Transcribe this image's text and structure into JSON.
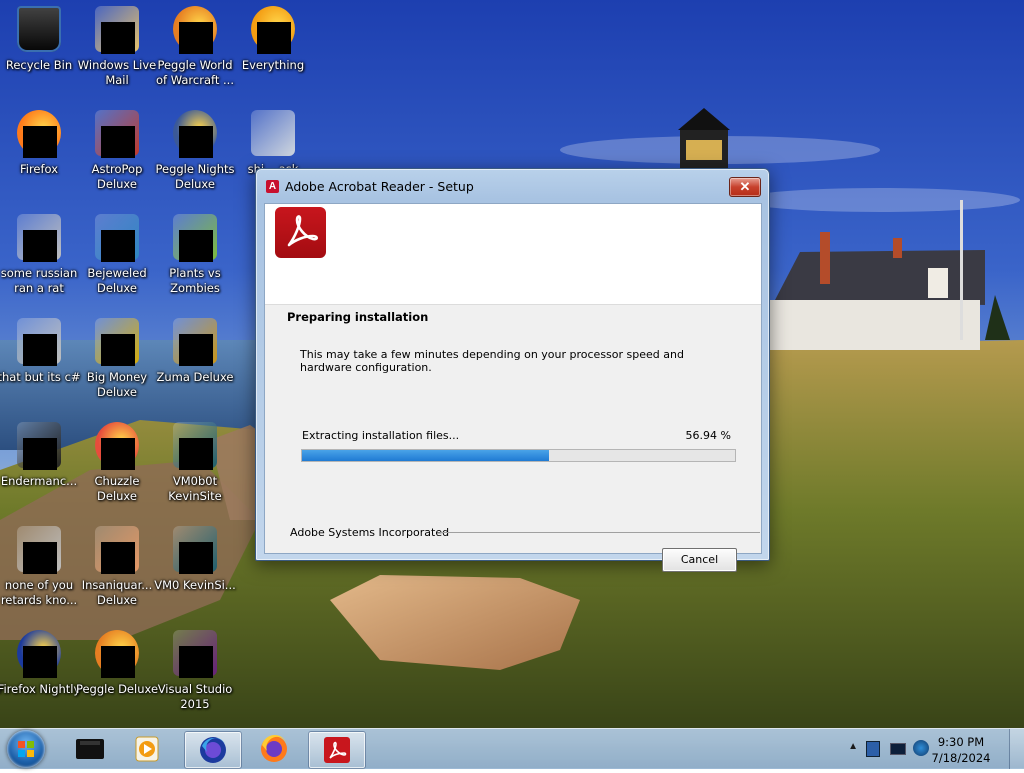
{
  "desktop": {
    "icons": [
      {
        "label": "Recycle Bin",
        "icon": "recycle-bin-icon",
        "redacted": false
      },
      {
        "label": "Windows Live Mail",
        "icon": "mail-icon",
        "redacted": true
      },
      {
        "label": "Peggle World of Warcraft ...",
        "icon": "peggle-wow-icon",
        "redacted": true
      },
      {
        "label": "Everything",
        "icon": "everything-icon",
        "redacted": true
      },
      {
        "label": "Firefox",
        "icon": "firefox-icon",
        "redacted": true
      },
      {
        "label": "AstroPop Deluxe",
        "icon": "astropop-icon",
        "redacted": true
      },
      {
        "label": "Peggle Nights Deluxe",
        "icon": "peggle-nights-icon",
        "redacted": true
      },
      {
        "label": "shi... ask",
        "icon": "folder-icon",
        "redacted": false
      },
      {
        "label": "some russian ran a rat",
        "icon": "shortcut-icon",
        "redacted": true
      },
      {
        "label": "Bejeweled Deluxe",
        "icon": "bejeweled-icon",
        "redacted": true
      },
      {
        "label": "Plants vs Zombies",
        "icon": "pvz-icon",
        "redacted": true
      },
      {
        "label": "that but its c#",
        "icon": "shortcut-icon",
        "redacted": true
      },
      {
        "label": "Big Money Deluxe",
        "icon": "big-money-icon",
        "redacted": true
      },
      {
        "label": "Zuma Deluxe",
        "icon": "zuma-icon",
        "redacted": true
      },
      {
        "label": "Endermanc...",
        "icon": "terminal-icon",
        "redacted": true
      },
      {
        "label": "Chuzzle Deluxe",
        "icon": "chuzzle-icon",
        "redacted": true
      },
      {
        "label": "VM0b0t KevinSite",
        "icon": "vm-icon",
        "redacted": true
      },
      {
        "label": "none of you retards kno...",
        "icon": "shortcut-icon",
        "redacted": true
      },
      {
        "label": "Insaniquar... Deluxe",
        "icon": "insaniquarium-icon",
        "redacted": true
      },
      {
        "label": "VM0 KevinSi...",
        "icon": "vm-icon",
        "redacted": true
      },
      {
        "label": "Firefox Nightly",
        "icon": "firefox-nightly-icon",
        "redacted": true
      },
      {
        "label": "Peggle Deluxe",
        "icon": "peggle-icon",
        "redacted": true
      },
      {
        "label": "Visual Studio 2015",
        "icon": "visual-studio-icon",
        "redacted": true
      }
    ]
  },
  "dialog": {
    "title": "Adobe Acrobat Reader - Setup",
    "close_glyph": "✕",
    "step_title": "Preparing installation",
    "description": "This may take a few minutes depending on your processor speed and hardware configuration.",
    "progress_label": "Extracting installation files...",
    "progress_text": "56.94 %",
    "progress_value": 0.5694,
    "company": "Adobe Systems Incorporated",
    "cancel_label": "Cancel"
  },
  "taskbar": {
    "buttons": [
      {
        "name": "taskbar-app-black-icon",
        "active": false
      },
      {
        "name": "taskbar-media-player-icon",
        "active": false
      },
      {
        "name": "taskbar-firefox-nightly-icon",
        "active": true
      },
      {
        "name": "taskbar-firefox-icon",
        "active": false
      },
      {
        "name": "taskbar-acrobat-icon",
        "active": true
      }
    ],
    "time": "9:30 PM",
    "date": "7/18/2024"
  }
}
